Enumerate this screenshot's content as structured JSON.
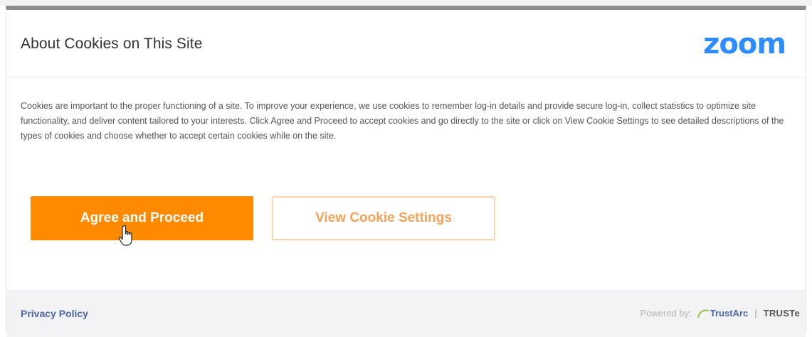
{
  "dialog": {
    "title": "About Cookies on This Site",
    "logo_text": "zoom",
    "body": "Cookies are important to the proper functioning of a site. To improve your experience, we use cookies to remember log-in details and provide secure log-in, collect statistics to optimize site functionality, and deliver content tailored to your interests. Click Agree and Proceed to accept cookies and go directly to the site or click on View Cookie Settings to see detailed descriptions of the types of cookies and choose whether to accept certain cookies while on the site.",
    "buttons": {
      "agree_label": "Agree and Proceed",
      "settings_label": "View Cookie Settings"
    }
  },
  "footer": {
    "privacy_label": "Privacy Policy",
    "powered_by": "Powered by:",
    "trustarc_label": "TrustArc",
    "separator": "|",
    "truste_label": "TRUSTe"
  },
  "icons": {
    "logo": "zoom-logo",
    "cursor": "hand-pointer-icon",
    "trustarc": "trustarc-arc-icon"
  },
  "colors": {
    "logo": "#2d8cff",
    "primary_button": "#ff8a00",
    "secondary_button_text": "#f5a15a",
    "link": "#4a67a8"
  }
}
